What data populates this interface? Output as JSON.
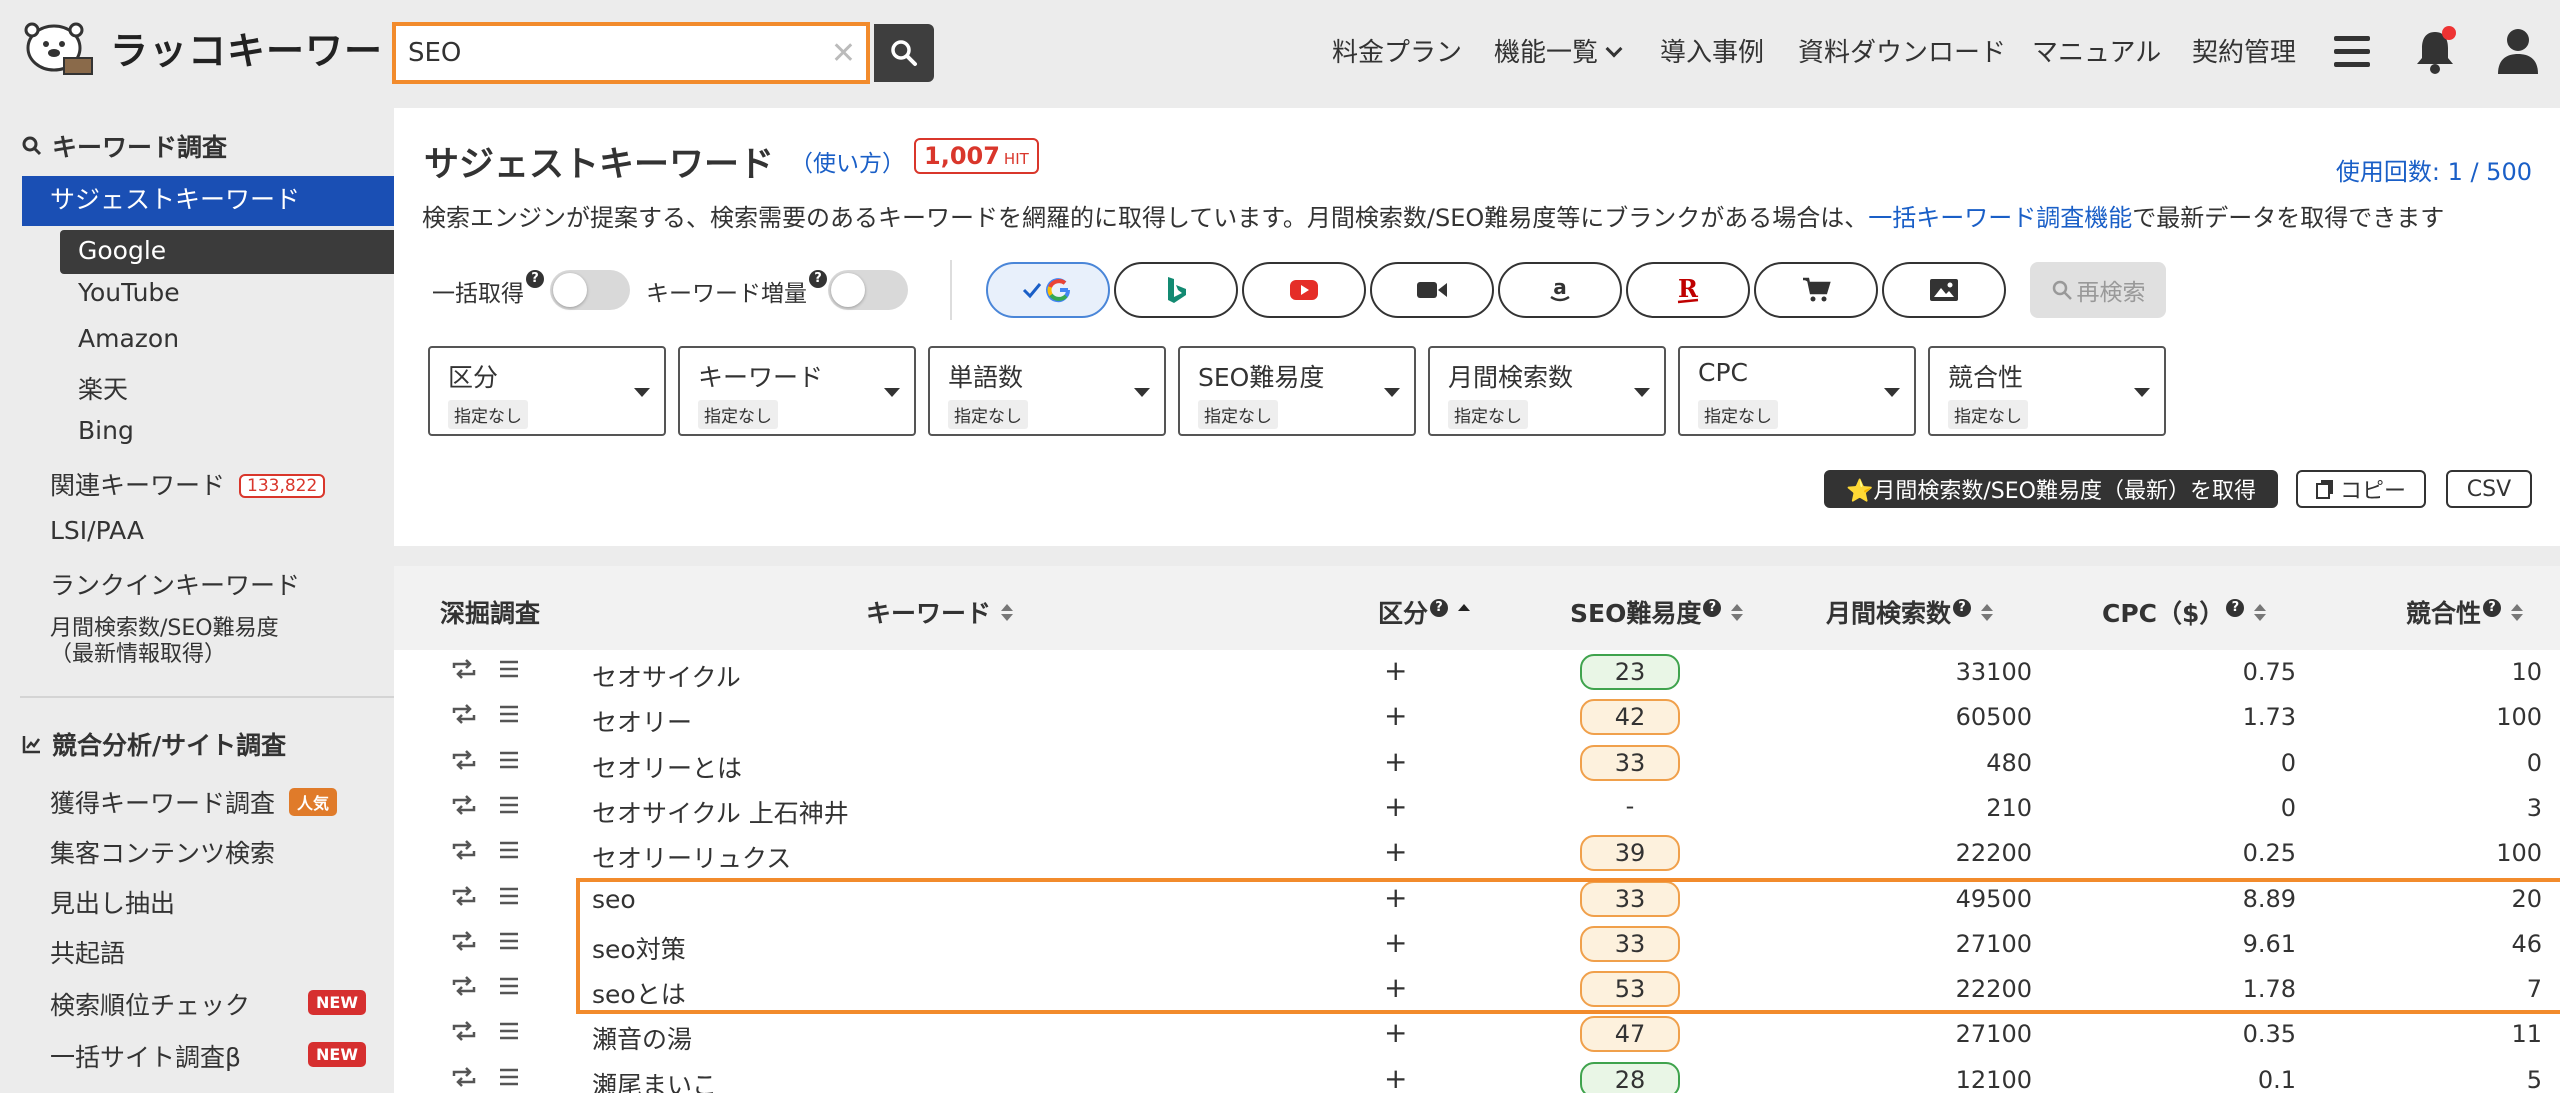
{
  "header": {
    "logo_text": "ラッコキーワード",
    "search_value": "SEO",
    "nav": [
      "料金プラン",
      "機能一覧",
      "導入事例",
      "資料ダウンロード",
      "マニュアル",
      "契約管理"
    ]
  },
  "sidebar": {
    "section1": "キーワード調査",
    "suggest": "サジェストキーワード",
    "engines": [
      "Google",
      "YouTube",
      "Amazon",
      "楽天",
      "Bing"
    ],
    "related": "関連キーワード",
    "related_count": "133,822",
    "lsi": "LSI/PAA",
    "rankin": "ランクインキーワード",
    "monthly_line1": "月間検索数/SEO難易度",
    "monthly_line2": "（最新情報取得）",
    "section2": "競合分析/サイト調査",
    "acquired": "獲得キーワード調査",
    "acquired_badge": "人気",
    "content_search": "集客コンテンツ検索",
    "headings": "見出し抽出",
    "cooccurrence": "共起語",
    "rank_check": "検索順位チェック",
    "bulk_site": "一括サイト調査β",
    "new_badge": "NEW"
  },
  "main": {
    "title": "サジェストキーワード",
    "howto": "（使い方）",
    "hit_count": "1,007",
    "hit_label": "HIT",
    "usage": "使用回数: 1 / 500",
    "desc_before": "検索エンジンが提案する、検索需要のあるキーワードを網羅的に取得しています。月間検索数/SEO難易度等にブランクがある場合は、",
    "desc_link": "一括キーワード調査機能",
    "desc_after": "で最新データを取得できます",
    "toggle_bulk": "一括取得",
    "toggle_increase": "キーワード増量",
    "research": "再検索",
    "filters": [
      {
        "title": "区分",
        "value": "指定なし"
      },
      {
        "title": "キーワード",
        "value": "指定なし"
      },
      {
        "title": "単語数",
        "value": "指定なし"
      },
      {
        "title": "SEO難易度",
        "value": "指定なし"
      },
      {
        "title": "月間検索数",
        "value": "指定なし"
      },
      {
        "title": "CPC",
        "value": "指定なし"
      },
      {
        "title": "競合性",
        "value": "指定なし"
      }
    ],
    "fetch_btn": "⭐月間検索数/SEO難易度（最新）を取得",
    "copy_btn": "コピー",
    "csv_btn": "CSV"
  },
  "table": {
    "headers": [
      "深掘調査",
      "キーワード",
      "区分",
      "SEO難易度",
      "月間検索数",
      "CPC（$）",
      "競合性"
    ],
    "rows": [
      {
        "kw": "セオサイクル",
        "seo": "23",
        "seo_color": "green",
        "vol": "33100",
        "cpc": "0.75",
        "comp": "10"
      },
      {
        "kw": "セオリー",
        "seo": "42",
        "seo_color": "orange",
        "vol": "60500",
        "cpc": "1.73",
        "comp": "100"
      },
      {
        "kw": "セオリーとは",
        "seo": "33",
        "seo_color": "orange",
        "vol": "480",
        "cpc": "0",
        "comp": "0"
      },
      {
        "kw": "セオサイクル 上石神井",
        "seo": "-",
        "seo_color": "none",
        "vol": "210",
        "cpc": "0",
        "comp": "3"
      },
      {
        "kw": "セオリーリュクス",
        "seo": "39",
        "seo_color": "orange",
        "vol": "22200",
        "cpc": "0.25",
        "comp": "100"
      },
      {
        "kw": "seo",
        "seo": "33",
        "seo_color": "orange",
        "vol": "49500",
        "cpc": "8.89",
        "comp": "20"
      },
      {
        "kw": "seo対策",
        "seo": "33",
        "seo_color": "orange",
        "vol": "27100",
        "cpc": "9.61",
        "comp": "46"
      },
      {
        "kw": "seoとは",
        "seo": "53",
        "seo_color": "orange",
        "vol": "22200",
        "cpc": "1.78",
        "comp": "7"
      },
      {
        "kw": "瀬音の湯",
        "seo": "47",
        "seo_color": "orange",
        "vol": "27100",
        "cpc": "0.35",
        "comp": "11"
      },
      {
        "kw": "瀬尾まいこ",
        "seo": "28",
        "seo_color": "green",
        "vol": "12100",
        "cpc": "0.1",
        "comp": "5"
      }
    ]
  },
  "colors": {
    "accent_blue": "#1a4fb4",
    "highlight_orange": "#f28b2c",
    "badge_red": "#d9362b"
  }
}
